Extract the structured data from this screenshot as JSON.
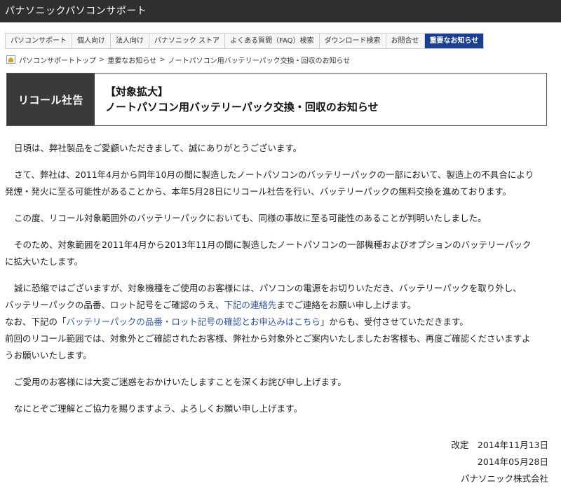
{
  "header": {
    "title": "パナソニックパソコンサポート"
  },
  "nav": {
    "items": [
      {
        "label": "パソコンサポート"
      },
      {
        "label": "個人向け"
      },
      {
        "label": "法人向け"
      },
      {
        "label": "パナソニック ストア"
      },
      {
        "label": "よくある質問（FAQ）検索"
      },
      {
        "label": "ダウンロード検索"
      },
      {
        "label": "お問合せ"
      },
      {
        "label": "重要なお知らせ"
      }
    ]
  },
  "breadcrumb": {
    "items": [
      "パソコンサポートトップ",
      "重要なお知らせ",
      "ノートパソコン用バッテリーパック交換・回収のお知らせ"
    ],
    "separator": ">"
  },
  "banner": {
    "label": "リコール社告",
    "title_line1": "【対象拡大】",
    "title_line2": "ノートパソコン用バッテリーパック交換・回収のお知らせ"
  },
  "body": {
    "p1": "日頃は、弊社製品をご愛顧いただきまして、誠にありがとうございます。",
    "p2_line1": "さて、弊社は、2011年4月から同年10月の間に製造したノートパソコンのバッテリーパックの一部において、製造上の不具合により",
    "p2_line2": "発煙・発火に至る可能性があることから、本年5月28日にリコール社告を行い、バッテリーパックの無料交換を進めております。",
    "p3": "この度、リコール対象範囲外のバッテリーパックにおいても、同様の事故に至る可能性のあることが判明いたしました。",
    "p4_line1": "そのため、対象範囲を2011年4月から2013年11月の間に製造したノートパソコンの一部機種およびオプションのバッテリーパック",
    "p4_line2": "に拡大いたします。",
    "p5_line1": "誠に恐縮ではございますが、対象機種をご使用のお客様には、パソコンの電源をお切りいただき、バッテリーパックを取り外し、",
    "p5_line2_pre": "バッテリーパックの品番、ロット記号をご確認のうえ、",
    "p5_line2_link": "下記の連絡先",
    "p5_line2_post": "までご連絡をお願い申し上げます。",
    "p5_line3_pre": "なお、下記の「",
    "p5_line3_link": "バッテリーパックの品番・ロット記号の確認とお申込みはこちら",
    "p5_line3_post": "」からも、受付させていただきます。",
    "p5_line4": "前回のリコール範囲では、対象外とご確認されたお客様、弊社から対象外とご案内いたしましたお客様も、再度ご確認くださいますよ",
    "p5_line5": "うお願いいたします。",
    "p6": "ご愛用のお客様には大変ご迷惑をおかけいたしますことを深くお詫び申し上げます。",
    "p7": "なにとぞご理解とご協力を賜りますよう、よろしくお願い申し上げます。"
  },
  "signature": {
    "revised": "改定　2014年11月13日",
    "date": "2014年05月28日",
    "company": "パナソニック株式会社"
  },
  "colors": {
    "header_bg": "#2f2f2f",
    "nav_active_bg": "#1b3f8f",
    "banner_label_bg": "#3a3a3a",
    "link": "#2f55a4"
  }
}
